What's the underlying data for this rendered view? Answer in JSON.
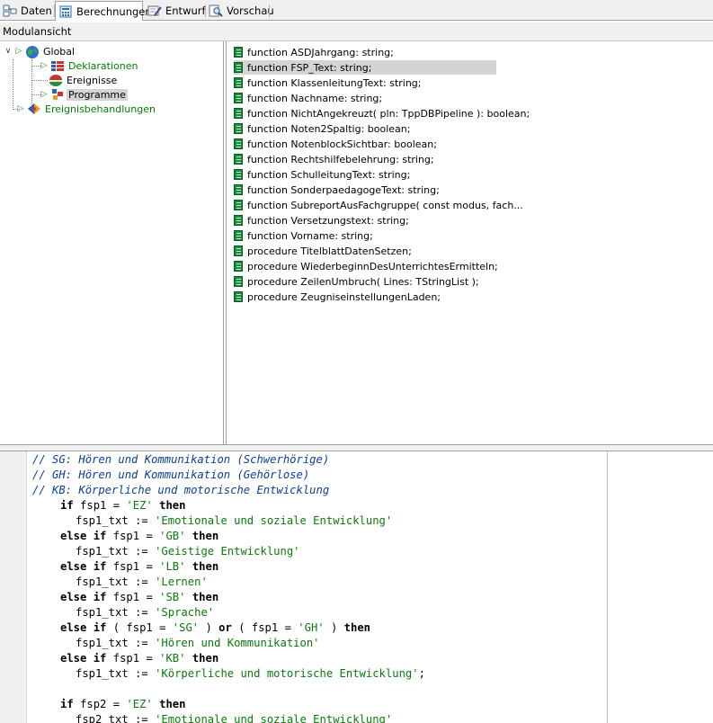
{
  "tabs": [
    {
      "label": "Daten",
      "icon": "data-tree-icon",
      "active": false
    },
    {
      "label": "Berechnungen",
      "icon": "calculator-icon",
      "active": true
    },
    {
      "label": "Entwurf",
      "icon": "design-pencil-icon",
      "active": false
    },
    {
      "label": "Vorschau",
      "icon": "preview-magnifier-icon",
      "active": false
    }
  ],
  "module_header": "Modulansicht",
  "tree": {
    "global": "Global",
    "deklarationen": "Deklarationen",
    "ereignisse": "Ereignisse",
    "programme": "Programme",
    "ereignisbehandlungen": "Ereignisbehandlungen"
  },
  "functions": [
    "function ASDJahrgang: string;",
    "function FSP_Text: string;",
    "function KlassenleitungText: string;",
    "function Nachname: string;",
    "function NichtAngekreuzt( pln: TppDBPipeline ): boolean;",
    "function Noten2Spaltig: boolean;",
    "function NotenblockSichtbar: boolean;",
    "function Rechtshilfebelehrung: string;",
    "function SchulleitungText: string;",
    "function SonderpaedagogeText: string;",
    "function SubreportAusFachgruppe( const modus, fach...",
    "function Versetzungstext: string;",
    "function Vorname: string;",
    "procedure TitelblattDatenSetzen;",
    "procedure WiederbeginnDesUnterrichtesErmitteln;",
    "procedure ZeilenUmbruch( Lines: TStringList );",
    "procedure ZeugniseinstellungenLaden;"
  ],
  "selected_function_index": 1,
  "code": {
    "c1": "// SG: Hören und Kommunikation (Schwerhörige)",
    "c2": "// GH: Hören und Kommunikation (Gehörlose)",
    "c3": "// KB: Körperliche und motorische Entwicklung",
    "kw_if": "if",
    "kw_else": "else",
    "kw_then": "then",
    "kw_or": "or",
    "fsp1": "fsp1",
    "fsp2": "fsp2",
    "fsp1_txt": "fsp1_txt",
    "fsp2_txt": "fsp2_txt",
    "assign": ":=",
    "eq": "=",
    "s_EZ": "'EZ'",
    "s_GB": "'GB'",
    "s_LB": "'LB'",
    "s_SB": "'SB'",
    "s_SG": "'SG'",
    "s_GH": "'GH'",
    "s_KB": "'KB'",
    "t_emot": "'Emotionale und soziale Entwicklung'",
    "t_geist": "'Geistige Entwicklung'",
    "t_lernen": "'Lernen'",
    "t_sprache": "'Sprache'",
    "t_hoeren": "'Hören und Kommunikation'",
    "t_koerper": "'Körperliche und motorische Entwicklung'",
    "t_emot_partial": "'Emotionale und soziale Entwicklung'"
  }
}
